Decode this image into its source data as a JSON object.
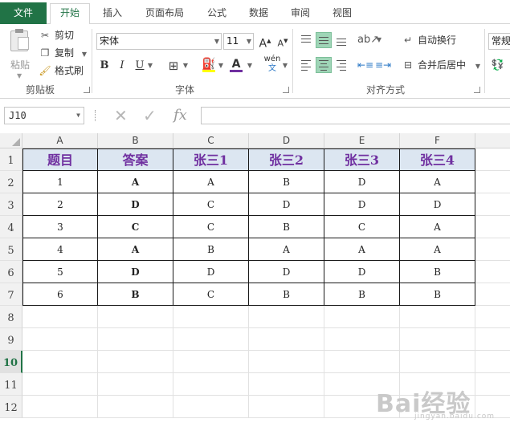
{
  "tabs": [
    {
      "label": "文件",
      "active": false,
      "file": true
    },
    {
      "label": "开始",
      "active": true
    },
    {
      "label": "插入"
    },
    {
      "label": "页面布局"
    },
    {
      "label": "公式"
    },
    {
      "label": "数据"
    },
    {
      "label": "审阅"
    },
    {
      "label": "视图"
    }
  ],
  "clipboard": {
    "paste_label": "粘贴",
    "cut_label": "剪切",
    "copy_label": "复制",
    "format_painter_label": "格式刷",
    "group_label": "剪贴板"
  },
  "font": {
    "font_name": "宋体",
    "font_size": "11",
    "group_label": "字体",
    "bold": "B",
    "italic": "I",
    "underline": "U",
    "phonetic": "wén"
  },
  "alignment": {
    "wrap_text_label": "自动换行",
    "merge_center_label": "合并后居中",
    "group_label": "对齐方式"
  },
  "number": {
    "format_label": "常规"
  },
  "formula_bar": {
    "name_box": "J10",
    "fx": "fx",
    "formula": ""
  },
  "columns": [
    "A",
    "B",
    "C",
    "D",
    "E",
    "F"
  ],
  "rows": [
    "1",
    "2",
    "3",
    "4",
    "5",
    "6",
    "7",
    "8",
    "9",
    "10",
    "11",
    "12"
  ],
  "active_row": "10",
  "table": {
    "headers": [
      "题目",
      "答案",
      "张三1",
      "张三2",
      "张三3",
      "张三4"
    ],
    "data": [
      [
        "1",
        "A",
        "A",
        "B",
        "D",
        "A"
      ],
      [
        "2",
        "D",
        "C",
        "D",
        "D",
        "D"
      ],
      [
        "3",
        "C",
        "C",
        "B",
        "C",
        "A"
      ],
      [
        "4",
        "A",
        "B",
        "A",
        "A",
        "A"
      ],
      [
        "5",
        "D",
        "D",
        "D",
        "D",
        "B"
      ],
      [
        "6",
        "B",
        "C",
        "B",
        "B",
        "B"
      ]
    ]
  },
  "watermark": {
    "text": "Bai经验",
    "sub": "jingyan.baidu.com"
  },
  "colors": {
    "accent": "#217346",
    "header_fill": "#dce6f1",
    "header_text": "#7030a0",
    "selected_button": "#9fd5b7"
  }
}
